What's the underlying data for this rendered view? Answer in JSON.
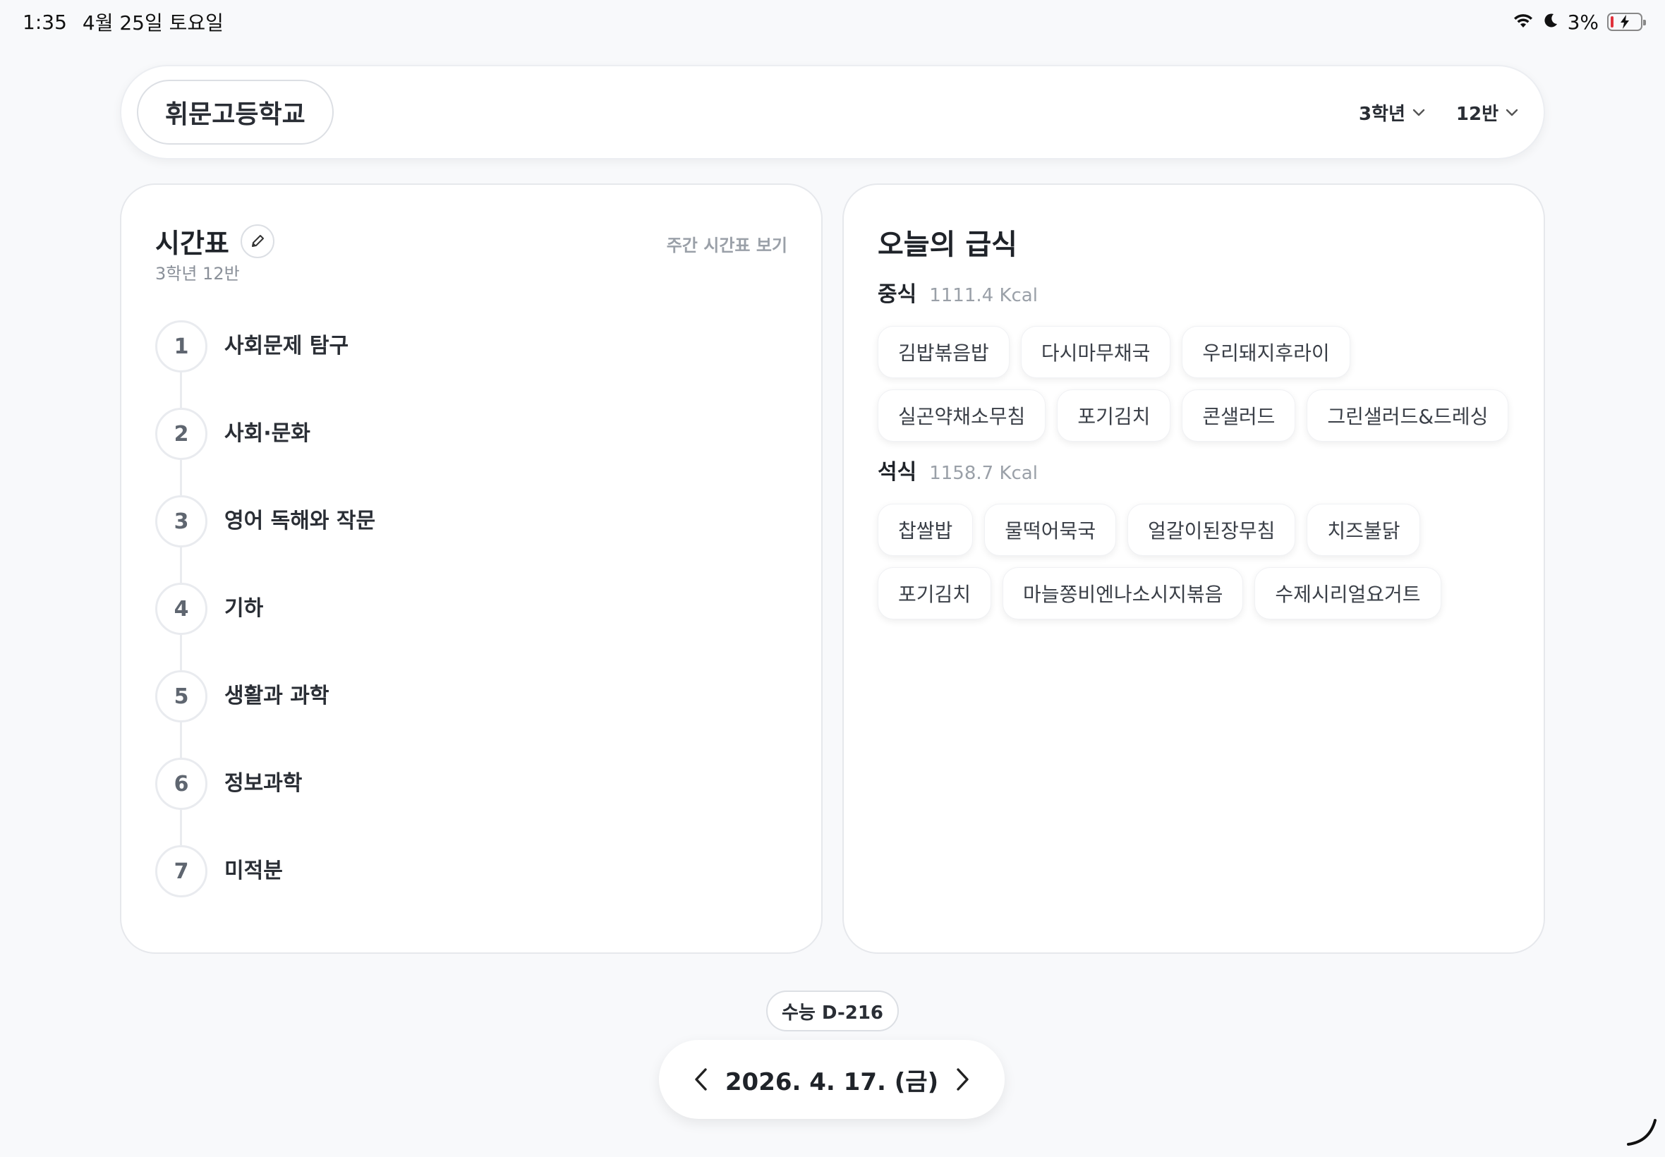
{
  "status_bar": {
    "time": "1:35",
    "date": "4월 25일 토요일",
    "battery": "3%",
    "icons": [
      "wifi-icon",
      "moon-icon",
      "battery-charging-icon"
    ]
  },
  "header": {
    "school_name": "휘문고등학교",
    "grade_select": "3학년",
    "class_select": "12반"
  },
  "timetable": {
    "title": "시간표",
    "subtitle": "3학년 12반",
    "weekly_link": "주간 시간표 보기",
    "periods": [
      {
        "num": "1",
        "subject": "사회문제 탐구"
      },
      {
        "num": "2",
        "subject": "사회·문화"
      },
      {
        "num": "3",
        "subject": "영어 독해와 작문"
      },
      {
        "num": "4",
        "subject": "기하"
      },
      {
        "num": "5",
        "subject": "생활과 과학"
      },
      {
        "num": "6",
        "subject": "정보과학"
      },
      {
        "num": "7",
        "subject": "미적분"
      }
    ]
  },
  "meal": {
    "title": "오늘의 급식",
    "lunch": {
      "label": "중식",
      "kcal": "1111.4 Kcal",
      "items": [
        "김밥볶음밥",
        "다시마무채국",
        "우리돼지후라이",
        "실곤약채소무침",
        "포기김치",
        "콘샐러드",
        "그린샐러드&드레싱"
      ]
    },
    "dinner": {
      "label": "석식",
      "kcal": "1158.7 Kcal",
      "items": [
        "찹쌀밥",
        "물떡어묵국",
        "얼갈이된장무침",
        "치즈불닭",
        "포기김치",
        "마늘쫑비엔나소시지볶음",
        "수제시리얼요거트"
      ]
    }
  },
  "footer": {
    "dday": "수능 D-216",
    "date": "2026. 4. 17. (금)"
  },
  "colors": {
    "background": "#f8f9fb",
    "card": "#ffffff",
    "battery_low": "#e0313b"
  }
}
